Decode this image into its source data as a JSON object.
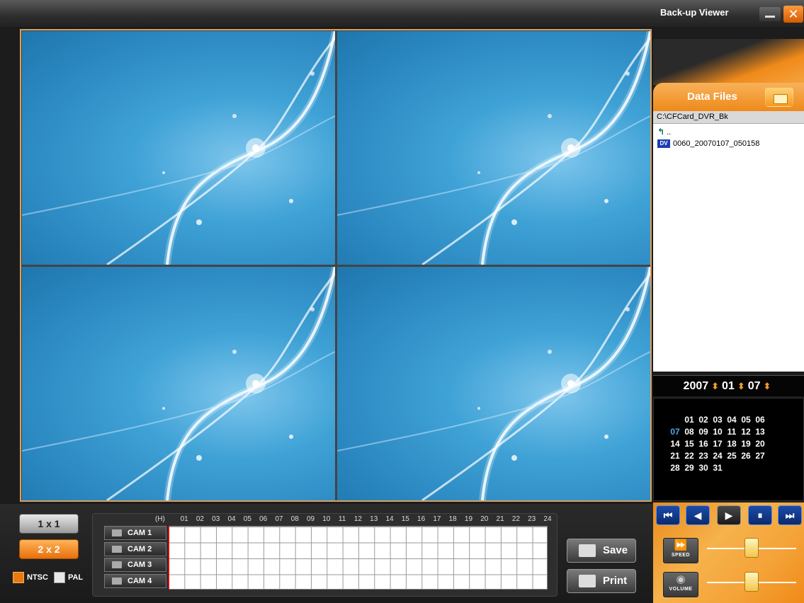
{
  "window": {
    "title": "Back-up Viewer",
    "close_glyph": "✕"
  },
  "data_files": {
    "header": "Data Files",
    "path": "C:\\CFCard_DVR_Bk",
    "up_label": "..",
    "files": [
      "0060_20070107_050158"
    ],
    "file_icon_text": "DV"
  },
  "date": {
    "year": "2007",
    "month": "01",
    "day": "07"
  },
  "calendar": {
    "selected": "07",
    "rows": [
      [
        "",
        "01",
        "02",
        "03",
        "04",
        "05",
        "06"
      ],
      [
        "07",
        "08",
        "09",
        "10",
        "11",
        "12",
        "13"
      ],
      [
        "14",
        "15",
        "16",
        "17",
        "18",
        "19",
        "20"
      ],
      [
        "21",
        "22",
        "23",
        "24",
        "25",
        "26",
        "27"
      ],
      [
        "28",
        "29",
        "30",
        "31",
        "",
        "",
        ""
      ]
    ]
  },
  "transport": {
    "buttons": [
      {
        "name": "skip-back",
        "glyph": "⏮"
      },
      {
        "name": "rewind",
        "glyph": "◀"
      },
      {
        "name": "play",
        "glyph": "▶"
      },
      {
        "name": "pause",
        "glyph": "⏸"
      },
      {
        "name": "skip-forward",
        "glyph": "⏭"
      }
    ],
    "speed_label": "SPEED",
    "volume_label": "VOLUME",
    "speed_level": 0.5,
    "volume_level": 0.5
  },
  "layout_buttons": {
    "one": "1 x 1",
    "four": "2 x 2"
  },
  "video_standard": {
    "ntsc": "NTSC",
    "pal": "PAL",
    "selected": "NTSC"
  },
  "timeline": {
    "hour_label": "(H)",
    "hours": [
      "01",
      "02",
      "03",
      "04",
      "05",
      "06",
      "07",
      "08",
      "09",
      "10",
      "11",
      "12",
      "13",
      "14",
      "15",
      "16",
      "17",
      "18",
      "19",
      "20",
      "21",
      "22",
      "23",
      "24"
    ],
    "cameras": [
      "CAM 1",
      "CAM 2",
      "CAM 3",
      "CAM 4"
    ]
  },
  "actions": {
    "save": "Save",
    "print": "Print"
  },
  "colors": {
    "accent": "#f08a1a",
    "panel": "#1c1c1c",
    "video_blue": "#3fa2d6"
  }
}
